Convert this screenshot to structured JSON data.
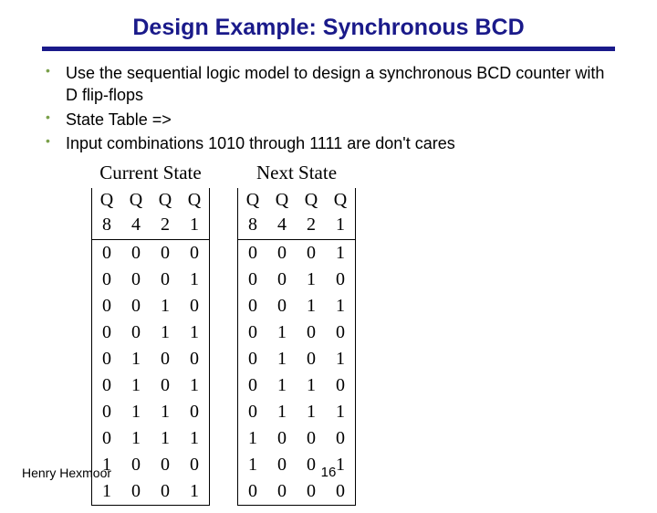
{
  "title": "Design Example:  Synchronous BCD",
  "bullets": [
    "Use the sequential logic model to design a synchronous BCD counter with D flip-flops",
    "State Table =>",
    "Input combinations 1010 through 1111 are don't cares"
  ],
  "table": {
    "group_headers": {
      "current": "Current State",
      "next": "Next State"
    },
    "cols": [
      "Q 8",
      "Q 4",
      "Q 2",
      "Q 1"
    ],
    "rows": [
      {
        "cur": [
          "0",
          "0",
          "0",
          "0"
        ],
        "nxt": [
          "0",
          "0",
          "0",
          "1"
        ]
      },
      {
        "cur": [
          "0",
          "0",
          "0",
          "1"
        ],
        "nxt": [
          "0",
          "0",
          "1",
          "0"
        ]
      },
      {
        "cur": [
          "0",
          "0",
          "1",
          "0"
        ],
        "nxt": [
          "0",
          "0",
          "1",
          "1"
        ]
      },
      {
        "cur": [
          "0",
          "0",
          "1",
          "1"
        ],
        "nxt": [
          "0",
          "1",
          "0",
          "0"
        ]
      },
      {
        "cur": [
          "0",
          "1",
          "0",
          "0"
        ],
        "nxt": [
          "0",
          "1",
          "0",
          "1"
        ]
      },
      {
        "cur": [
          "0",
          "1",
          "0",
          "1"
        ],
        "nxt": [
          "0",
          "1",
          "1",
          "0"
        ]
      },
      {
        "cur": [
          "0",
          "1",
          "1",
          "0"
        ],
        "nxt": [
          "0",
          "1",
          "1",
          "1"
        ]
      },
      {
        "cur": [
          "0",
          "1",
          "1",
          "1"
        ],
        "nxt": [
          "1",
          "0",
          "0",
          "0"
        ]
      },
      {
        "cur": [
          "1",
          "0",
          "0",
          "0"
        ],
        "nxt": [
          "1",
          "0",
          "0",
          "1"
        ]
      },
      {
        "cur": [
          "1",
          "0",
          "0",
          "1"
        ],
        "nxt": [
          "0",
          "0",
          "0",
          "0"
        ]
      }
    ]
  },
  "footer": {
    "author": "Henry Hexmoor",
    "page": "16"
  }
}
